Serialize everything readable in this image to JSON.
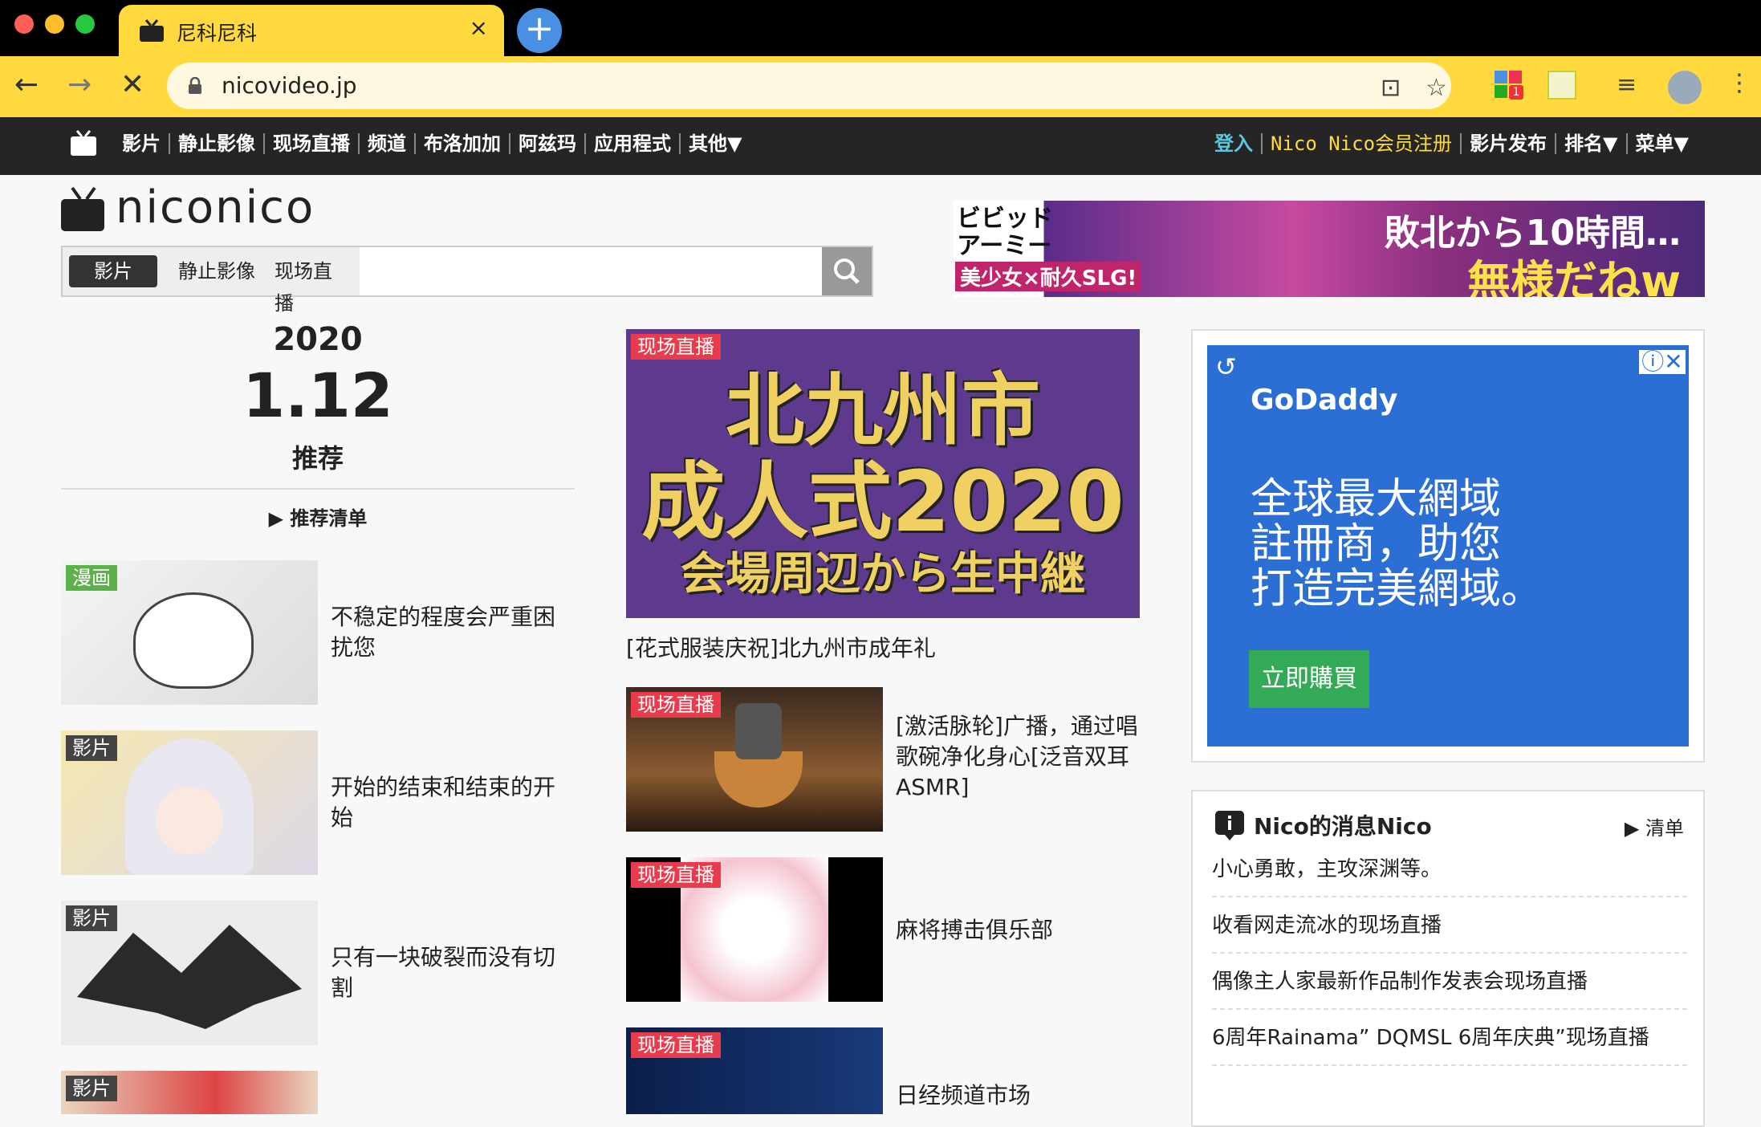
{
  "browser": {
    "tab_title": "尼科尼科",
    "url": "nicovideo.jp",
    "new_tab_label": "+",
    "close_label": "×",
    "ext_badge": "1"
  },
  "sitenav": {
    "left": [
      "影片",
      "静止影像",
      "现场直播",
      "频道",
      "布洛加加",
      "阿兹玛",
      "应用程式",
      "其他▼"
    ],
    "right": [
      "登入",
      "Nico Nico会员注册",
      "影片发布",
      "排名▼",
      "菜单▼"
    ]
  },
  "logo": {
    "text": "niconico"
  },
  "search": {
    "tabs": [
      "影片",
      "静止影像",
      "现场直播"
    ],
    "placeholder": ""
  },
  "banner": {
    "left_title": "ビビッド\nアーミー",
    "left_sub": "美少女×耐久SLG!",
    "title1": "敗北から10時間…",
    "title2": "無様だねw"
  },
  "recommend": {
    "year": "2020",
    "day": "1.12",
    "label": "推荐",
    "list_link": "▶ 推荐清单"
  },
  "cards": [
    {
      "badge": "漫画",
      "title": "不稳定的程度会严重困扰您"
    },
    {
      "badge": "影片",
      "title": "开始的结束和结束的开始"
    },
    {
      "badge": "影片",
      "title": "只有一块破裂而没有切割"
    },
    {
      "badge": "影片",
      "title": ""
    }
  ],
  "feature": {
    "badge": "现场直播",
    "line1": "北九州市",
    "line2": "成人式2020",
    "line3": "会場周辺から生中継",
    "caption": "[花式服装庆祝]北九州市成年礼"
  },
  "live_cards": [
    {
      "badge": "现场直播",
      "title": "[激活脉轮]广播，通过唱歌碗净化身心[泛音双耳ASMR]"
    },
    {
      "badge": "现场直播",
      "title": "麻将搏击俱乐部"
    },
    {
      "badge": "现场直播",
      "title": "日经频道市场"
    }
  ],
  "ad": {
    "brand": "GoDaddy",
    "text": "全球最大網域\n註冊商，助您\n打造完美網域。",
    "button": "立即購買"
  },
  "news": {
    "header": "Nico的消息Nico",
    "more": "▶ 清单",
    "items": [
      "小心勇敢，主攻深渊等。",
      "收看网走流冰的现场直播",
      "偶像主人家最新作品制作发表会现场直播",
      "6周年Rainama” DQMSL 6周年庆典”现场直播"
    ]
  },
  "colors": {
    "accent": "#ffd93d",
    "nav": "#252525",
    "live": "#e83b4b",
    "manga": "#5bb14a"
  }
}
